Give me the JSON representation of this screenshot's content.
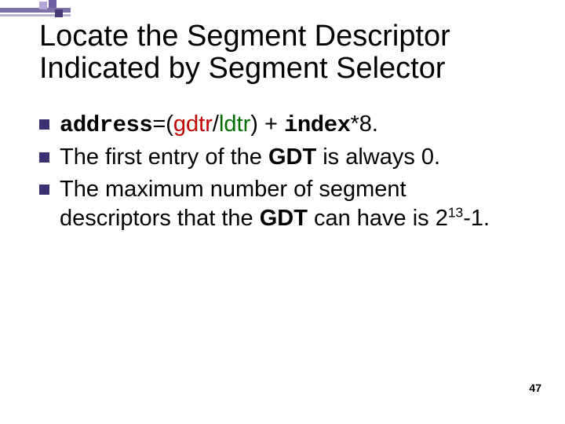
{
  "title_line1": "Locate the Segment Descriptor",
  "title_line2": "Indicated by Segment Selector",
  "bullet1": {
    "address": "address",
    "eq_open": "=(",
    "gdtr": "gdtr",
    "slash": "/",
    "ldtr": "ldtr",
    "close_plus": ") + ",
    "index": "index",
    "tail": "*8."
  },
  "bullet2": {
    "pre": "The first entry of the ",
    "gdt": "GDT",
    "post": " is always 0."
  },
  "bullet3": {
    "pre": "The maximum number of segment descriptors that the ",
    "gdt": "GDT",
    "mid": " can have is 2",
    "exp": "13",
    "post": "-1."
  },
  "page_number": "47"
}
